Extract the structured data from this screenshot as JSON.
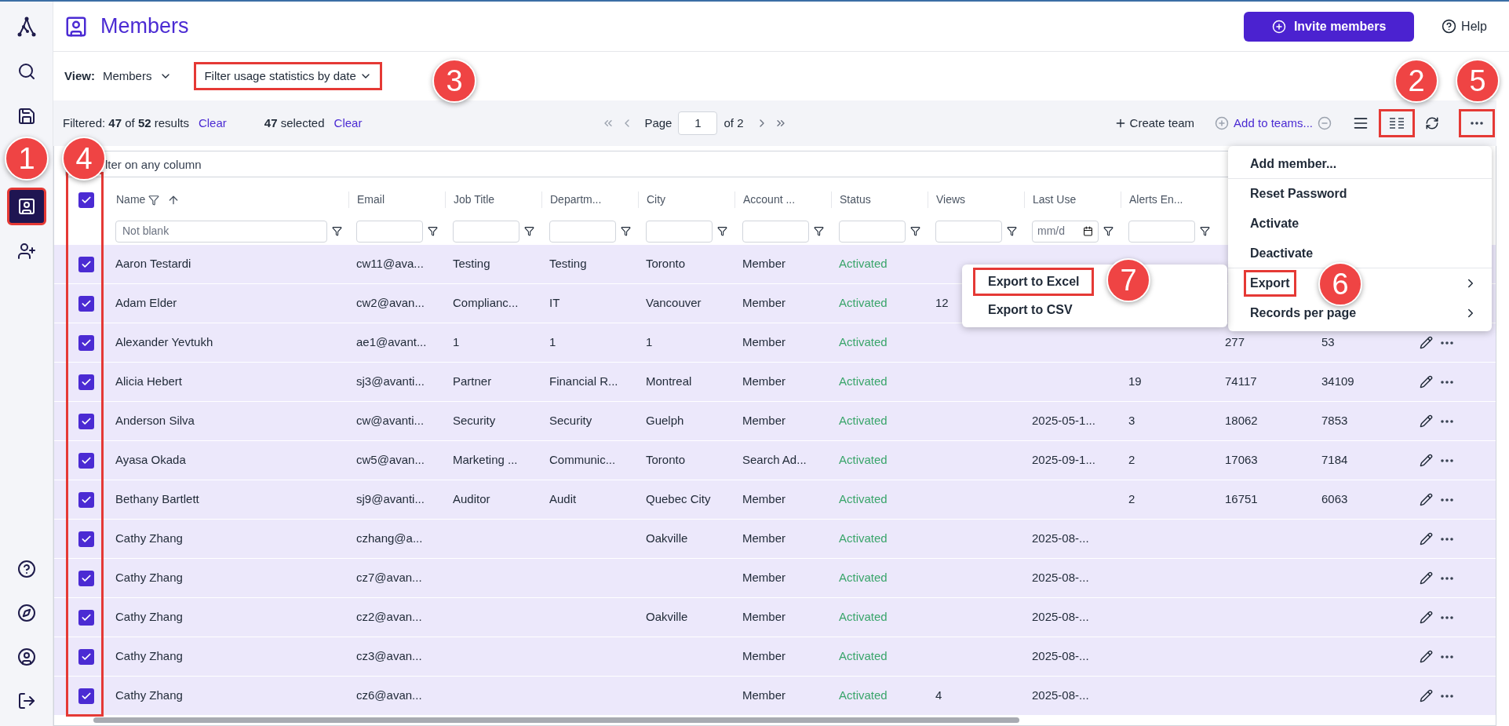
{
  "sidebar": {
    "items": [
      {
        "selected": false,
        "highlighted": false
      },
      {
        "selected": false,
        "highlighted": false
      },
      {
        "selected": false,
        "highlighted": false
      },
      {
        "selected": true,
        "highlighted": true
      },
      {
        "selected": false,
        "highlighted": false
      }
    ],
    "bottom_items": [
      {
        "selected": false
      },
      {
        "selected": false
      },
      {
        "selected": false
      },
      {
        "selected": false
      }
    ]
  },
  "header": {
    "title": "Members",
    "invite_button": "Invite members",
    "help": "Help"
  },
  "view_bar": {
    "view_label": "View:",
    "view_value": "Members",
    "date_filter": {
      "label": "Filter usage statistics by date",
      "highlighted": true
    }
  },
  "toolbar": {
    "filtered_text": "Filtered: **47** of **52** results",
    "filtered_clear": "Clear",
    "selected_text": "**47** selected",
    "selected_clear": "Clear",
    "page_label": "Page",
    "page_value": "1",
    "page_of": "of 2",
    "create_team": "Create team",
    "add_to_teams": "Add to teams...",
    "columns_button_highlighted": true,
    "more_button_highlighted": true
  },
  "filter_field": {
    "placeholder": "lter on any column"
  },
  "table": {
    "all_selected": true,
    "checkbox_column_highlighted": true,
    "columns": [
      {
        "label": "Name",
        "filtered": true,
        "sorted": true,
        "filter_value": "Not blank",
        "kind": "text"
      },
      {
        "label": "Email",
        "kind": "text"
      },
      {
        "label": "Job Title",
        "kind": "text"
      },
      {
        "label": "Departm...",
        "kind": "text"
      },
      {
        "label": "City",
        "kind": "text"
      },
      {
        "label": "Account ...",
        "kind": "text"
      },
      {
        "label": "Status",
        "kind": "text"
      },
      {
        "label": "Views",
        "kind": "text"
      },
      {
        "label": "Last Use",
        "kind": "date",
        "filter_placeholder": "mm/d"
      },
      {
        "label": "Alerts En...",
        "kind": "text"
      }
    ],
    "rows": [
      {
        "selected": true,
        "name": "Aaron Testardi",
        "email": "cw11@ava...",
        "job_title": "Testing",
        "department": "Testing",
        "city": "Toronto",
        "account": "Member",
        "status": "Activated"
      },
      {
        "selected": true,
        "name": "Adam Elder",
        "email": "cw2@avan...",
        "job_title": "Complianc...",
        "department": "IT",
        "city": "Vancouver",
        "account": "Member",
        "status": "Activated",
        "views": "12"
      },
      {
        "selected": true,
        "name": "Alexander Yevtukh",
        "email": "ae1@avant...",
        "job_title": "1",
        "department": "1",
        "city": "1",
        "account": "Member",
        "status": "Activated",
        "column_11": "277",
        "column_12": "53"
      },
      {
        "selected": true,
        "name": "Alicia Hebert",
        "email": "sj3@avanti...",
        "job_title": "Partner",
        "department": "Financial R...",
        "city": "Montreal",
        "account": "Member",
        "status": "Activated",
        "alerts": "19",
        "column_11": "74117",
        "column_12": "34109"
      },
      {
        "selected": true,
        "name": "Anderson Silva",
        "email": "cw@avanti...",
        "job_title": "Security",
        "department": "Security",
        "city": "Guelph",
        "account": "Member",
        "status": "Activated",
        "last_use": "2025-05-1...",
        "alerts": "3",
        "column_11": "18062",
        "column_12": "7853"
      },
      {
        "selected": true,
        "name": "Ayasa Okada",
        "email": "cw5@avan...",
        "job_title": "Marketing ...",
        "department": "Communic...",
        "city": "Toronto",
        "account": "Search Ad...",
        "status": "Activated",
        "last_use": "2025-09-1...",
        "alerts": "2",
        "column_11": "17063",
        "column_12": "7184"
      },
      {
        "selected": true,
        "name": "Bethany Bartlett",
        "email": "sj9@avanti...",
        "job_title": "Auditor",
        "department": "Audit",
        "city": "Quebec City",
        "account": "Member",
        "status": "Activated",
        "alerts": "2",
        "column_11": "16751",
        "column_12": "6063"
      },
      {
        "selected": true,
        "name": "Cathy Zhang",
        "email": "czhang@a...",
        "city": "Oakville",
        "account": "Member",
        "status": "Activated",
        "last_use": "2025-08-..."
      },
      {
        "selected": true,
        "name": "Cathy Zhang",
        "email": "cz7@avan...",
        "account": "Member",
        "status": "Activated",
        "last_use": "2025-08-..."
      },
      {
        "selected": true,
        "name": "Cathy Zhang",
        "email": "cz2@avan...",
        "city": "Oakville",
        "account": "Member",
        "status": "Activated",
        "last_use": "2025-08-..."
      },
      {
        "selected": true,
        "name": "Cathy Zhang",
        "email": "cz3@avan...",
        "account": "Member",
        "status": "Activated",
        "last_use": "2025-08-..."
      },
      {
        "selected": true,
        "name": "Cathy Zhang",
        "email": "cz6@avan...",
        "account": "Member",
        "status": "Activated",
        "views": "4",
        "last_use": "2025-08-..."
      }
    ]
  },
  "more_menu": {
    "items": [
      {
        "label": "Add member...",
        "submenu": false,
        "highlighted": false
      },
      {
        "label": "Reset Password",
        "submenu": false,
        "highlighted": false
      },
      {
        "label": "Activate",
        "submenu": false,
        "highlighted": false
      },
      {
        "label": "Deactivate",
        "submenu": false,
        "highlighted": false
      },
      {
        "label": "Export",
        "submenu": true,
        "highlighted": true
      },
      {
        "label": "Records per page",
        "submenu": true,
        "highlighted": false
      }
    ]
  },
  "export_submenu": {
    "items": [
      {
        "label": "Export to Excel",
        "highlighted": true
      },
      {
        "label": "Export to CSV",
        "highlighted": false
      }
    ]
  },
  "callouts": [
    {
      "label": "3"
    },
    {
      "label": "2"
    },
    {
      "label": "5"
    },
    {
      "label": "1"
    },
    {
      "label": "4"
    },
    {
      "label": "7"
    },
    {
      "label": "6"
    }
  ]
}
